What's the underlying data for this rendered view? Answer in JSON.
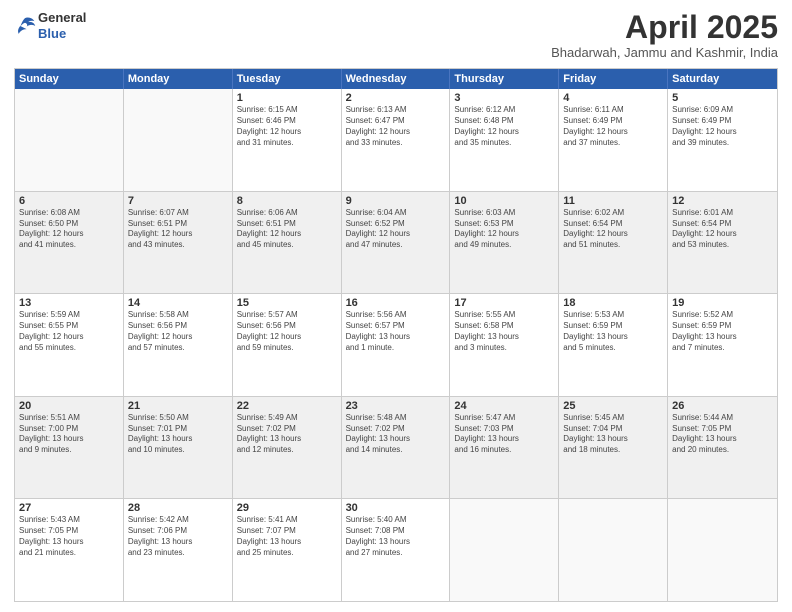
{
  "header": {
    "logo_general": "General",
    "logo_blue": "Blue",
    "month_year": "April 2025",
    "location": "Bhadarwah, Jammu and Kashmir, India"
  },
  "days": [
    "Sunday",
    "Monday",
    "Tuesday",
    "Wednesday",
    "Thursday",
    "Friday",
    "Saturday"
  ],
  "weeks": [
    [
      {
        "day": "",
        "lines": []
      },
      {
        "day": "",
        "lines": []
      },
      {
        "day": "1",
        "lines": [
          "Sunrise: 6:15 AM",
          "Sunset: 6:46 PM",
          "Daylight: 12 hours",
          "and 31 minutes."
        ]
      },
      {
        "day": "2",
        "lines": [
          "Sunrise: 6:13 AM",
          "Sunset: 6:47 PM",
          "Daylight: 12 hours",
          "and 33 minutes."
        ]
      },
      {
        "day": "3",
        "lines": [
          "Sunrise: 6:12 AM",
          "Sunset: 6:48 PM",
          "Daylight: 12 hours",
          "and 35 minutes."
        ]
      },
      {
        "day": "4",
        "lines": [
          "Sunrise: 6:11 AM",
          "Sunset: 6:49 PM",
          "Daylight: 12 hours",
          "and 37 minutes."
        ]
      },
      {
        "day": "5",
        "lines": [
          "Sunrise: 6:09 AM",
          "Sunset: 6:49 PM",
          "Daylight: 12 hours",
          "and 39 minutes."
        ]
      }
    ],
    [
      {
        "day": "6",
        "lines": [
          "Sunrise: 6:08 AM",
          "Sunset: 6:50 PM",
          "Daylight: 12 hours",
          "and 41 minutes."
        ]
      },
      {
        "day": "7",
        "lines": [
          "Sunrise: 6:07 AM",
          "Sunset: 6:51 PM",
          "Daylight: 12 hours",
          "and 43 minutes."
        ]
      },
      {
        "day": "8",
        "lines": [
          "Sunrise: 6:06 AM",
          "Sunset: 6:51 PM",
          "Daylight: 12 hours",
          "and 45 minutes."
        ]
      },
      {
        "day": "9",
        "lines": [
          "Sunrise: 6:04 AM",
          "Sunset: 6:52 PM",
          "Daylight: 12 hours",
          "and 47 minutes."
        ]
      },
      {
        "day": "10",
        "lines": [
          "Sunrise: 6:03 AM",
          "Sunset: 6:53 PM",
          "Daylight: 12 hours",
          "and 49 minutes."
        ]
      },
      {
        "day": "11",
        "lines": [
          "Sunrise: 6:02 AM",
          "Sunset: 6:54 PM",
          "Daylight: 12 hours",
          "and 51 minutes."
        ]
      },
      {
        "day": "12",
        "lines": [
          "Sunrise: 6:01 AM",
          "Sunset: 6:54 PM",
          "Daylight: 12 hours",
          "and 53 minutes."
        ]
      }
    ],
    [
      {
        "day": "13",
        "lines": [
          "Sunrise: 5:59 AM",
          "Sunset: 6:55 PM",
          "Daylight: 12 hours",
          "and 55 minutes."
        ]
      },
      {
        "day": "14",
        "lines": [
          "Sunrise: 5:58 AM",
          "Sunset: 6:56 PM",
          "Daylight: 12 hours",
          "and 57 minutes."
        ]
      },
      {
        "day": "15",
        "lines": [
          "Sunrise: 5:57 AM",
          "Sunset: 6:56 PM",
          "Daylight: 12 hours",
          "and 59 minutes."
        ]
      },
      {
        "day": "16",
        "lines": [
          "Sunrise: 5:56 AM",
          "Sunset: 6:57 PM",
          "Daylight: 13 hours",
          "and 1 minute."
        ]
      },
      {
        "day": "17",
        "lines": [
          "Sunrise: 5:55 AM",
          "Sunset: 6:58 PM",
          "Daylight: 13 hours",
          "and 3 minutes."
        ]
      },
      {
        "day": "18",
        "lines": [
          "Sunrise: 5:53 AM",
          "Sunset: 6:59 PM",
          "Daylight: 13 hours",
          "and 5 minutes."
        ]
      },
      {
        "day": "19",
        "lines": [
          "Sunrise: 5:52 AM",
          "Sunset: 6:59 PM",
          "Daylight: 13 hours",
          "and 7 minutes."
        ]
      }
    ],
    [
      {
        "day": "20",
        "lines": [
          "Sunrise: 5:51 AM",
          "Sunset: 7:00 PM",
          "Daylight: 13 hours",
          "and 9 minutes."
        ]
      },
      {
        "day": "21",
        "lines": [
          "Sunrise: 5:50 AM",
          "Sunset: 7:01 PM",
          "Daylight: 13 hours",
          "and 10 minutes."
        ]
      },
      {
        "day": "22",
        "lines": [
          "Sunrise: 5:49 AM",
          "Sunset: 7:02 PM",
          "Daylight: 13 hours",
          "and 12 minutes."
        ]
      },
      {
        "day": "23",
        "lines": [
          "Sunrise: 5:48 AM",
          "Sunset: 7:02 PM",
          "Daylight: 13 hours",
          "and 14 minutes."
        ]
      },
      {
        "day": "24",
        "lines": [
          "Sunrise: 5:47 AM",
          "Sunset: 7:03 PM",
          "Daylight: 13 hours",
          "and 16 minutes."
        ]
      },
      {
        "day": "25",
        "lines": [
          "Sunrise: 5:45 AM",
          "Sunset: 7:04 PM",
          "Daylight: 13 hours",
          "and 18 minutes."
        ]
      },
      {
        "day": "26",
        "lines": [
          "Sunrise: 5:44 AM",
          "Sunset: 7:05 PM",
          "Daylight: 13 hours",
          "and 20 minutes."
        ]
      }
    ],
    [
      {
        "day": "27",
        "lines": [
          "Sunrise: 5:43 AM",
          "Sunset: 7:05 PM",
          "Daylight: 13 hours",
          "and 21 minutes."
        ]
      },
      {
        "day": "28",
        "lines": [
          "Sunrise: 5:42 AM",
          "Sunset: 7:06 PM",
          "Daylight: 13 hours",
          "and 23 minutes."
        ]
      },
      {
        "day": "29",
        "lines": [
          "Sunrise: 5:41 AM",
          "Sunset: 7:07 PM",
          "Daylight: 13 hours",
          "and 25 minutes."
        ]
      },
      {
        "day": "30",
        "lines": [
          "Sunrise: 5:40 AM",
          "Sunset: 7:08 PM",
          "Daylight: 13 hours",
          "and 27 minutes."
        ]
      },
      {
        "day": "",
        "lines": []
      },
      {
        "day": "",
        "lines": []
      },
      {
        "day": "",
        "lines": []
      }
    ]
  ]
}
